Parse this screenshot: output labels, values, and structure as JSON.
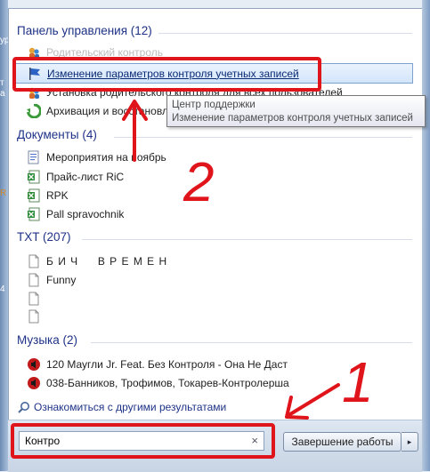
{
  "background_window_fragments": [
    "ур",
    "т",
    "а",
    "R",
    "4"
  ],
  "groups": {
    "control_panel": {
      "title": "Панель управления (12)",
      "items": [
        {
          "label": "Родительский контроль",
          "icon": "parental-control-icon"
        },
        {
          "label": "Изменение параметров контроля учетных записей",
          "icon": "uac-flag-icon",
          "selected": true
        },
        {
          "label": "Установка родительского контроля для всех пользователей",
          "icon": "parental-control-icon"
        },
        {
          "label": "Архивация и восстановление",
          "icon": "backup-icon"
        }
      ]
    },
    "documents": {
      "title": "Документы (4)",
      "items": [
        {
          "label": "Мероприятия на ноябрь",
          "icon": "word-doc-icon"
        },
        {
          "label": "Прайс-лист RiC",
          "icon": "excel-icon"
        },
        {
          "label": "RPK",
          "icon": "excel-icon"
        },
        {
          "label": "Pall spravochnik",
          "icon": "excel-icon"
        }
      ]
    },
    "txt": {
      "title": "TXT (207)",
      "items": [
        {
          "label": "Б И Ч     В Р Е М Е Н",
          "icon": "text-file-icon"
        },
        {
          "label": "Funny",
          "icon": "text-file-icon"
        },
        {
          "label": "",
          "icon": "text-file-icon"
        },
        {
          "label": "",
          "icon": "text-file-icon"
        }
      ]
    },
    "music": {
      "title": "Музыка (2)",
      "items": [
        {
          "label": "120 Маугли Jr. Feat. Без Контроля - Она Не Даст",
          "icon": "audio-file-icon"
        },
        {
          "label": "038-Банников, Трофимов, Токарев-Контролерша",
          "icon": "audio-file-icon"
        }
      ]
    }
  },
  "tooltip": {
    "line1": "Центр поддержки",
    "line2": "Изменение параметров контроля учетных записей"
  },
  "more_results": "Ознакомиться с другими результатами",
  "search": {
    "value": "Контро",
    "clear": "×"
  },
  "shutdown": {
    "label": "Завершение работы",
    "arrow": "▸"
  },
  "annotations": {
    "label_1": "1",
    "label_2": "2",
    "color": "#e0141b"
  }
}
